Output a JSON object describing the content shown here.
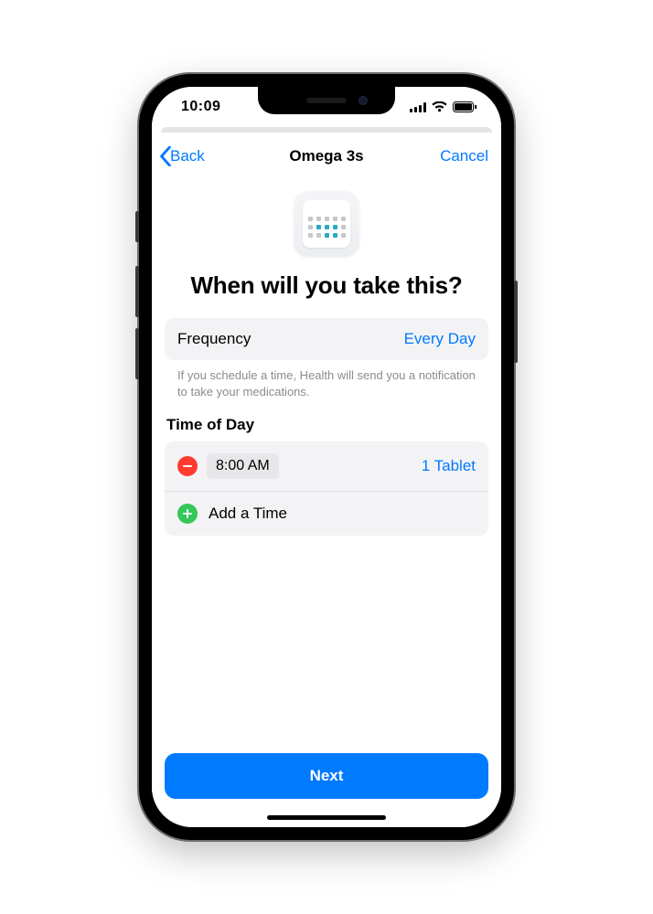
{
  "statusBar": {
    "time": "10:09"
  },
  "nav": {
    "backLabel": "Back",
    "title": "Omega 3s",
    "cancelLabel": "Cancel"
  },
  "page": {
    "title": "When will you take this?"
  },
  "frequency": {
    "label": "Frequency",
    "value": "Every Day"
  },
  "footnote": "If you schedule a time, Health will send you a notification to take your medications.",
  "timeSection": {
    "header": "Time of Day",
    "entries": [
      {
        "time": "8:00 AM",
        "dose": "1 Tablet"
      }
    ],
    "addLabel": "Add a Time"
  },
  "primaryButton": "Next",
  "colors": {
    "tint": "#007aff",
    "destructive": "#ff3b30",
    "positive": "#34c759"
  }
}
